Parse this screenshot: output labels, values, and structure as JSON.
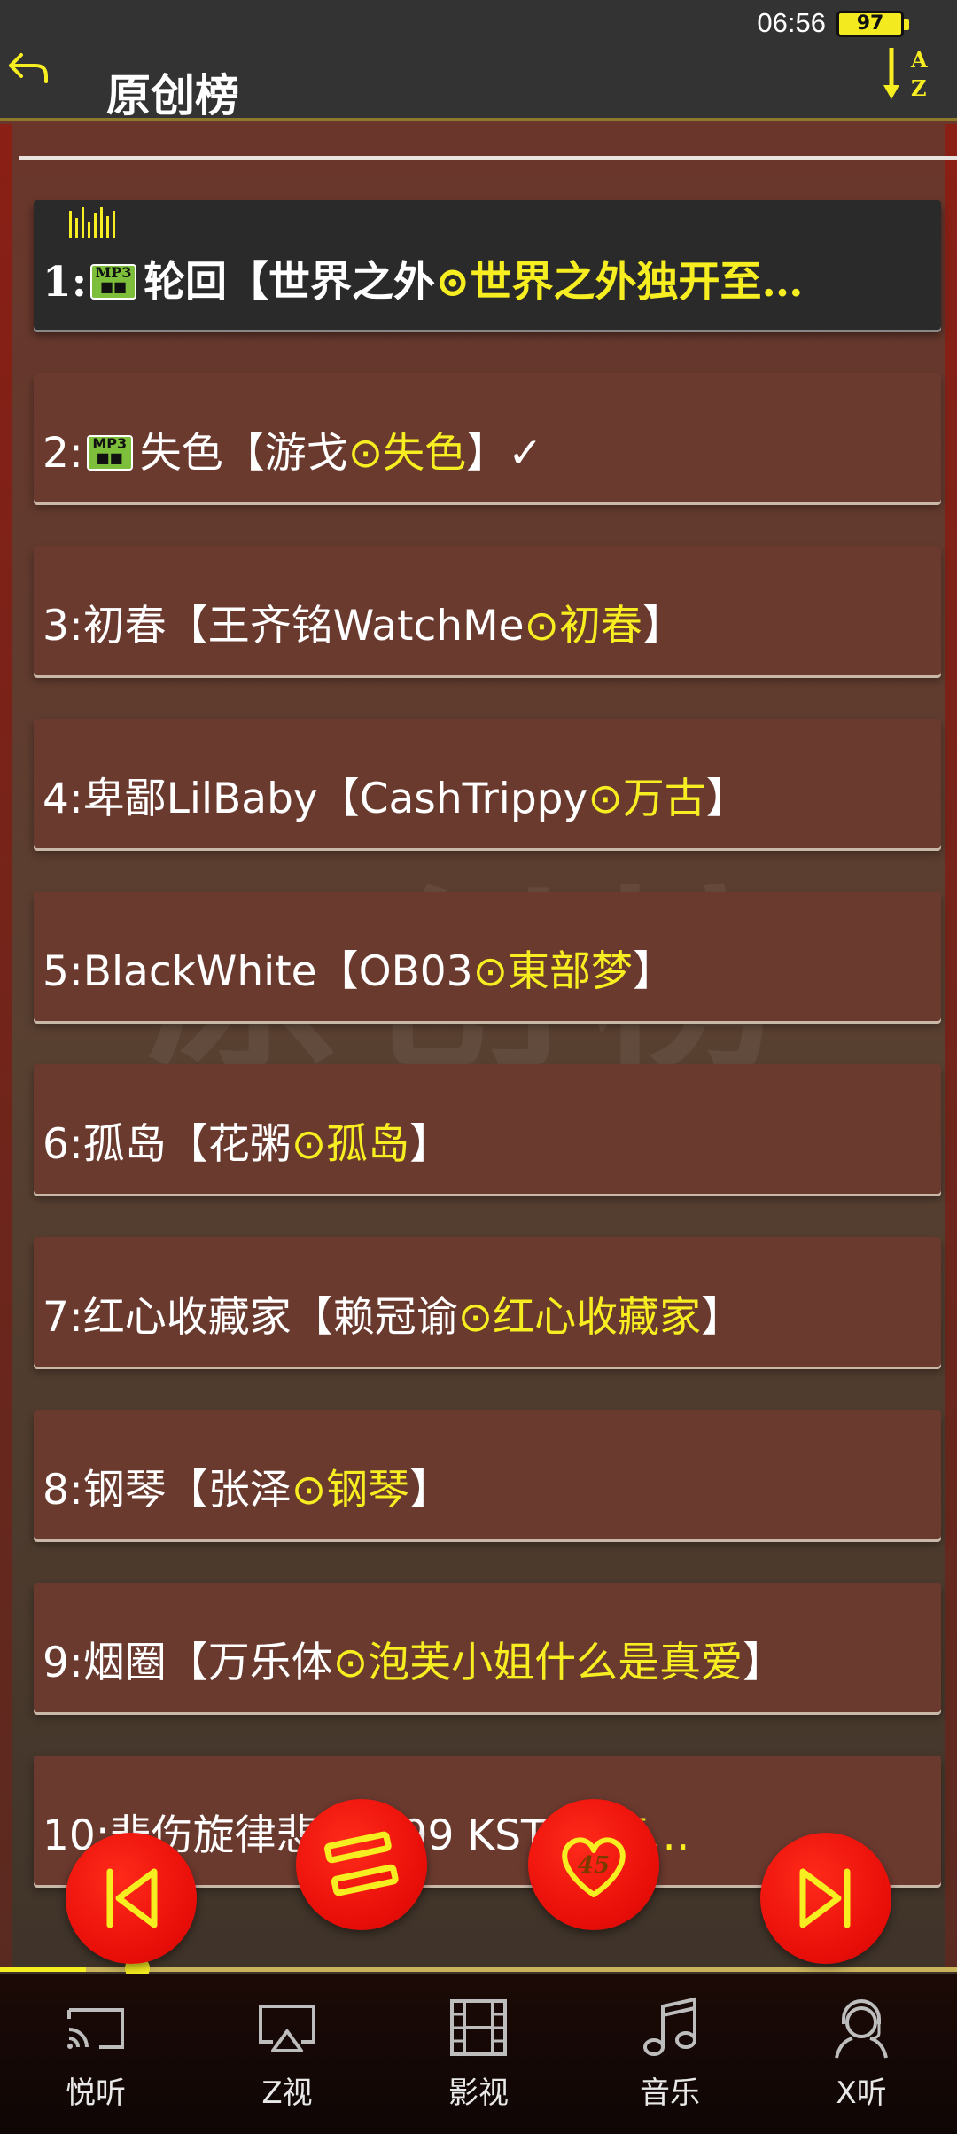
{
  "status_bar": {
    "time": "06:56",
    "battery": "97"
  },
  "header": {
    "title": "原创榜"
  },
  "songs": [
    {
      "num": "1:",
      "has_mp3": true,
      "title": "轮回【世界之外",
      "sep": "⊙",
      "highlight": "世界之外独开至…",
      "suffix": ""
    },
    {
      "num": "2:",
      "has_mp3": true,
      "title": "失色【游戈",
      "sep": "⊙",
      "highlight": "失色",
      "suffix": "】✓"
    },
    {
      "num": "3:",
      "has_mp3": false,
      "title": "初春【王齐铭WatchMe",
      "sep": "⊙",
      "highlight": "初春",
      "suffix": "】"
    },
    {
      "num": "4:",
      "has_mp3": false,
      "title": "卑鄙LilBaby【CashTrippy",
      "sep": "⊙",
      "highlight": "万古",
      "suffix": "】"
    },
    {
      "num": "5:",
      "has_mp3": false,
      "title": "BlackWhite【OB03",
      "sep": "⊙",
      "highlight": "東部梦",
      "suffix": "】"
    },
    {
      "num": "6:",
      "has_mp3": false,
      "title": "孤岛【花粥",
      "sep": "⊙",
      "highlight": "孤岛",
      "suffix": "】"
    },
    {
      "num": "7:",
      "has_mp3": false,
      "title": "红心收藏家【赖冠谕",
      "sep": "⊙",
      "highlight": "红心收藏家",
      "suffix": "】"
    },
    {
      "num": "8:",
      "has_mp3": false,
      "title": "钢琴【张泽",
      "sep": "⊙",
      "highlight": "钢琴",
      "suffix": "】"
    },
    {
      "num": "9:",
      "has_mp3": false,
      "title": "烟圈【万乐体",
      "sep": "⊙",
      "highlight": "泡芙小姐什么是真爱",
      "suffix": "】"
    },
    {
      "num": "10:",
      "has_mp3": false,
      "title": "悲伤旋律悲伤【99 KSTA",
      "sep": "⊙",
      "highlight": "悲…",
      "suffix": ""
    }
  ],
  "mp3_badge": {
    "top": "MP3",
    "bottom": "■■"
  },
  "player": {
    "favorite_count": "45",
    "progress": 0.09
  },
  "bottom_nav": [
    {
      "label": "悦听",
      "icon": "cast-icon"
    },
    {
      "label": "Z视",
      "icon": "airplay-icon"
    },
    {
      "label": "影视",
      "icon": "film-icon"
    },
    {
      "label": "音乐",
      "icon": "music-note-icon"
    },
    {
      "label": "X听",
      "icon": "headset-person-icon"
    }
  ],
  "colors": {
    "accent": "#f7ee21",
    "fab": "#e70d08",
    "topbar": "#333333"
  }
}
